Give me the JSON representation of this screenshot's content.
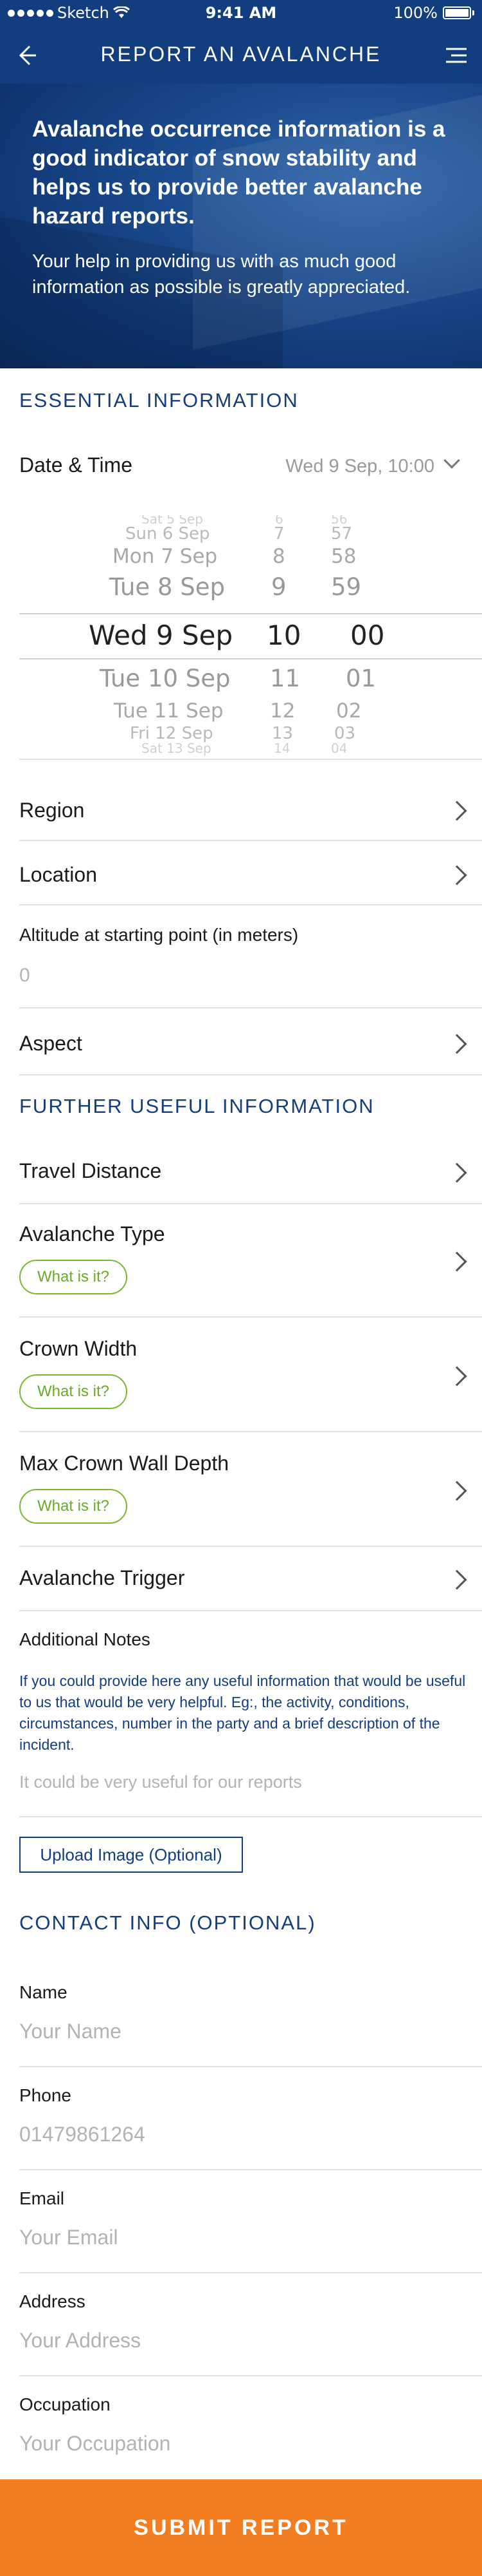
{
  "status_bar": {
    "carrier": "Sketch",
    "time": "9:41 AM",
    "battery": "100%"
  },
  "nav": {
    "title": "REPORT AN AVALANCHE",
    "back_icon": "back-arrow-icon",
    "menu_icon": "hamburger-menu-icon"
  },
  "hero": {
    "heading": "Avalanche occurrence information is a good indicator of snow stability and helps us to provide better avalanche hazard reports.",
    "body": "Your help in providing us with as much good information as possible is greatly appreciated."
  },
  "essential": {
    "title": "ESSENTIAL INFORMATION",
    "date_time_label": "Date & Time",
    "date_time_value": "Wed 9 Sep, 10:00",
    "picker": {
      "days": [
        "Sat 5 Sep",
        "Sun 6 Sep",
        "Mon 7 Sep",
        "Tue 8 Sep",
        "Wed 9 Sep",
        "Tue 10 Sep",
        "Tue 11 Sep",
        "Fri 12 Sep",
        "Sat 13 Sep"
      ],
      "hours": [
        "6",
        "7",
        "8",
        "9",
        "10",
        "11",
        "12",
        "13",
        "14"
      ],
      "minutes": [
        "56",
        "57",
        "58",
        "59",
        "00",
        "01",
        "02",
        "03",
        "04"
      ]
    },
    "region_label": "Region",
    "location_label": "Location",
    "altitude_label": "Altitude at starting point (in meters)",
    "altitude_placeholder": "0",
    "aspect_label": "Aspect"
  },
  "further": {
    "title": "FURTHER USEFUL INFORMATION",
    "travel_distance_label": "Travel Distance",
    "avalanche_type_label": "Avalanche Type",
    "crown_width_label": "Crown Width",
    "crown_depth_label": "Max Crown Wall Depth",
    "what_is_it": "What is it?",
    "trigger_label": "Avalanche Trigger",
    "notes_label": "Additional Notes",
    "notes_help": "If you could provide here any useful information that would be useful to us that would be very helpful. Eg:, the activity, conditions, circumstances, number in the party and a brief description of the incident.",
    "notes_placeholder": "It could be very useful for our reports",
    "upload_label": "Upload Image (Optional)"
  },
  "contact": {
    "title": "CONTACT INFO (OPTIONAL)",
    "name_label": "Name",
    "name_placeholder": "Your Name",
    "phone_label": "Phone",
    "phone_placeholder": "01479861264",
    "email_label": "Email",
    "email_placeholder": "Your Email",
    "address_label": "Address",
    "address_placeholder": "Your Address",
    "occupation_label": "Occupation",
    "occupation_placeholder": "Your Occupation"
  },
  "submit_label": "SUBMIT REPORT",
  "colors": {
    "primary": "#123e80",
    "accent": "#f37d21",
    "green": "#7ab834"
  }
}
